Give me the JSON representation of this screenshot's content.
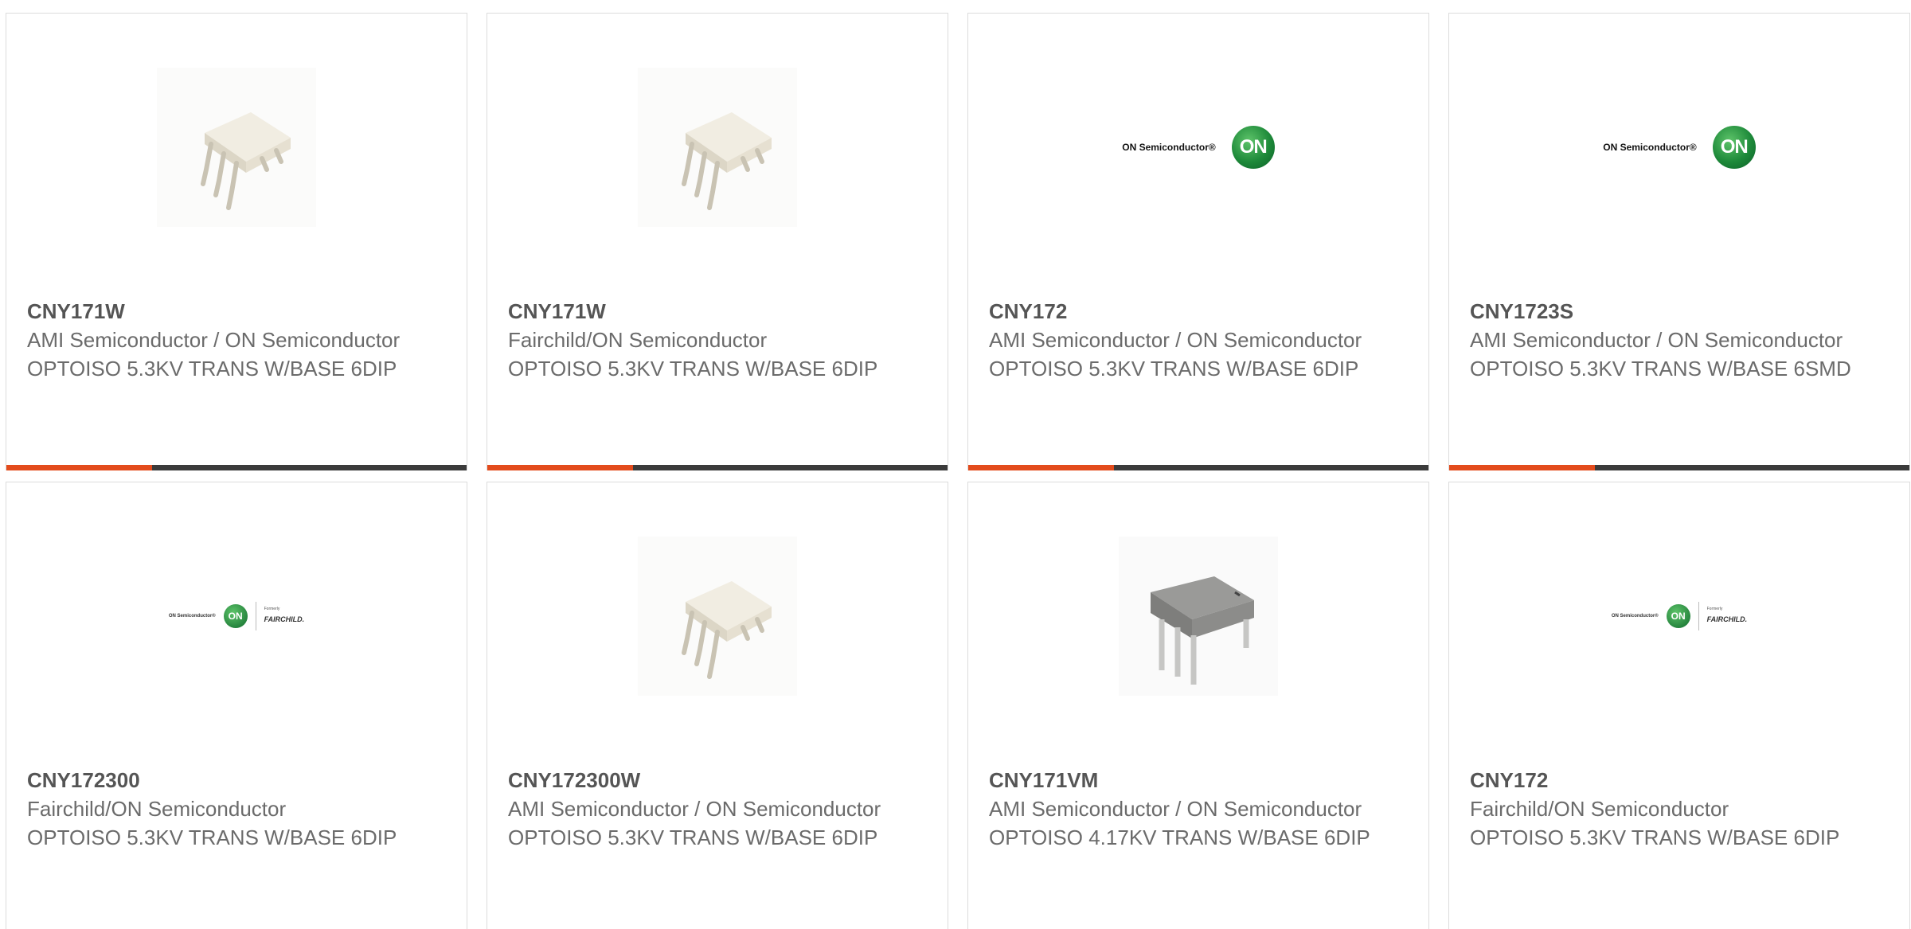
{
  "products": [
    {
      "part": "CNY171W",
      "manufacturer": "AMI Semiconductor / ON Semiconductor",
      "description": "OPTOISO 5.3KV TRANS W/BASE 6DIP",
      "image": "dip6-white-chip-icon"
    },
    {
      "part": "CNY171W",
      "manufacturer": "Fairchild/ON Semiconductor",
      "description": "OPTOISO 5.3KV TRANS W/BASE 6DIP",
      "image": "dip6-white-chip-icon"
    },
    {
      "part": "CNY172",
      "manufacturer": "AMI Semiconductor / ON Semiconductor",
      "description": "OPTOISO 5.3KV TRANS W/BASE 6DIP",
      "image": "on-semiconductor-logo"
    },
    {
      "part": "CNY1723S",
      "manufacturer": "AMI Semiconductor / ON Semiconductor",
      "description": "OPTOISO 5.3KV TRANS W/BASE 6SMD",
      "image": "on-semiconductor-logo"
    },
    {
      "part": "CNY172300",
      "manufacturer": "Fairchild/ON Semiconductor",
      "description": "OPTOISO 5.3KV TRANS W/BASE 6DIP",
      "image": "on-fairchild-logo"
    },
    {
      "part": "CNY172300W",
      "manufacturer": "AMI Semiconductor / ON Semiconductor",
      "description": "OPTOISO 5.3KV TRANS W/BASE 6DIP",
      "image": "dip6-white-chip-icon"
    },
    {
      "part": "CNY171VM",
      "manufacturer": "AMI Semiconductor / ON Semiconductor",
      "description": "OPTOISO 4.17KV TRANS W/BASE 6DIP",
      "image": "dip6-gray-chip-icon"
    },
    {
      "part": "CNY172",
      "manufacturer": "Fairchild/ON Semiconductor",
      "description": "OPTOISO 5.3KV TRANS W/BASE 6DIP",
      "image": "on-fairchild-logo"
    }
  ],
  "logos": {
    "on_semiconductor": "ON Semiconductor®",
    "on_badge": "ON",
    "formerly": "Formerly",
    "fairchild": "FAIRCHILD."
  },
  "colors": {
    "accent": "#e34b1c",
    "bar": "#3b3b3b",
    "border": "#dcdcdc",
    "text": "#6b6b6b"
  }
}
